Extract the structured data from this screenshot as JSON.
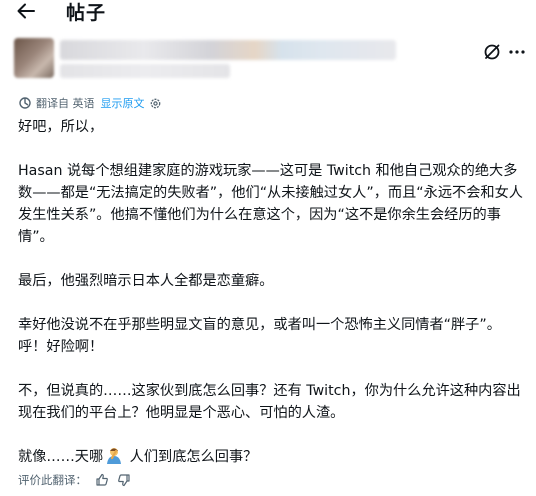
{
  "header": {
    "title": "帖子"
  },
  "icons": {
    "back": "back-arrow-icon",
    "grok": "grok-icon",
    "more": "more-icon",
    "translate": "translate-icon",
    "settings": "gear-icon",
    "thumb_up": "thumb-up-icon",
    "thumb_down": "thumb-down-icon",
    "emoji": "person-facepalming-emoji"
  },
  "translation": {
    "label": "翻译自 英语",
    "show_original": "显示原文"
  },
  "post": {
    "p1": "好吧，所以，",
    "p2": "Hasan 说每个想组建家庭的游戏玩家——这可是 Twitch 和他自己观众的绝大多数——都是“无法搞定的失败者”，他们“从未接触过女人”，而且“永远不会和女人发生性关系”。他搞不懂他们为什么在意这个，因为“这不是你余生会经历的事情”。",
    "p3": "最后，他强烈暗示日本人全都是恋童癖。",
    "p4": "幸好他没说不在乎那些明显文盲的意见，或者叫一个恐怖主义同情者“胖子”。呼！好险啊！",
    "p5": "不，但说真的……这家伙到底怎么回事？还有 Twitch，你为什么允许这种内容出现在我们的平台上？他明显是个恶心、可怕的人渣。",
    "p6_before": "就像……天哪",
    "p6_after": " 人们到底怎么回事？"
  },
  "rating": {
    "label": "评价此翻译："
  },
  "colors": {
    "link": "#1d9bf0",
    "muted": "#536471",
    "text": "#0f1419"
  }
}
